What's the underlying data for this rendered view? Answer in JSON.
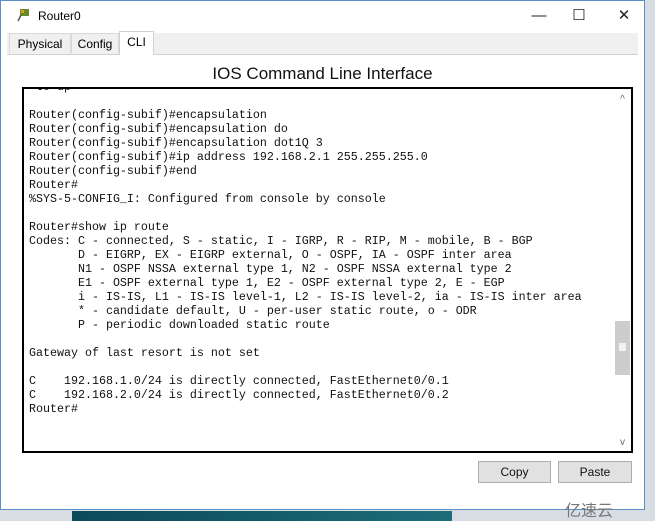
{
  "window": {
    "title": "Router0",
    "minimize": "—",
    "maximize": "☐",
    "close": "✕"
  },
  "tabs": [
    {
      "label": "Physical"
    },
    {
      "label": "Config"
    },
    {
      "label": "CLI",
      "active": true
    }
  ],
  "heading": "IOS Command Line Interface",
  "terminal": {
    "lines": [
      " to up",
      "",
      "Router(config-subif)#encapsulation",
      "Router(config-subif)#encapsulation do",
      "Router(config-subif)#encapsulation dot1Q 3",
      "Router(config-subif)#ip address 192.168.2.1 255.255.255.0",
      "Router(config-subif)#end",
      "Router#",
      "%SYS-5-CONFIG_I: Configured from console by console",
      "",
      "Router#show ip route",
      "Codes: C - connected, S - static, I - IGRP, R - RIP, M - mobile, B - BGP",
      "       D - EIGRP, EX - EIGRP external, O - OSPF, IA - OSPF inter area",
      "       N1 - OSPF NSSA external type 1, N2 - OSPF NSSA external type 2",
      "       E1 - OSPF external type 1, E2 - OSPF external type 2, E - EGP",
      "       i - IS-IS, L1 - IS-IS level-1, L2 - IS-IS level-2, ia - IS-IS inter area",
      "       * - candidate default, U - per-user static route, o - ODR",
      "       P - periodic downloaded static route",
      "",
      "Gateway of last resort is not set",
      "",
      "C    192.168.1.0/24 is directly connected, FastEthernet0/0.1",
      "C    192.168.2.0/24 is directly connected, FastEthernet0/0.2",
      "Router#"
    ]
  },
  "scrollbar": {
    "up": "^",
    "down": "v"
  },
  "buttons": {
    "copy": "Copy",
    "paste": "Paste"
  },
  "watermark": "亿速云"
}
